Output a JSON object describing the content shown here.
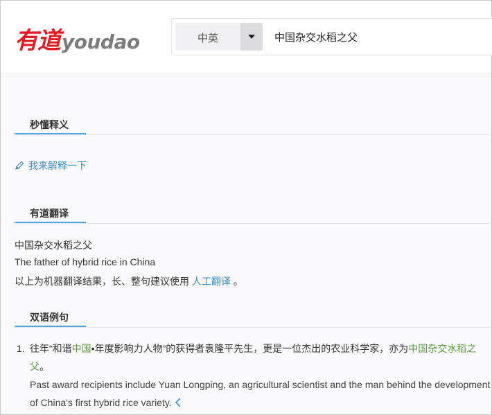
{
  "header": {
    "logo_cn": "有道",
    "logo_en": "youdao",
    "lang_select": "中英",
    "search_value": "中国杂交水稻之父"
  },
  "sections": {
    "quick": {
      "title": "秒懂释义",
      "edit_link": "我来解释一下"
    },
    "translation": {
      "title": "有道翻译",
      "source": "中国杂交水稻之父",
      "result": "The father of hybrid rice in China",
      "note_prefix": "以上为机器翻译结果，长、整句建议使用",
      "note_link": "人工翻译",
      "note_suffix": "。"
    },
    "examples": {
      "title": "双语例句",
      "items": [
        {
          "num": "1.",
          "cn_parts": {
            "p1": "往年“和谐",
            "h1": "中国",
            "p2": "•年度影响力人物”的获得者袁隆平先生，更是一位杰出的农业科学家，亦为",
            "h2": "中国杂交水稻之父",
            "p3": "。"
          },
          "en": "Past award recipients include Yuan Longping, an agricultural scientist and the man behind the development of China's first hybrid rice variety."
        }
      ]
    }
  },
  "colors": {
    "accent_blue": "#4aa6df",
    "link_blue": "#3a8cc4",
    "highlight_green": "#5c9a3b",
    "logo_red": "#e31c23"
  }
}
